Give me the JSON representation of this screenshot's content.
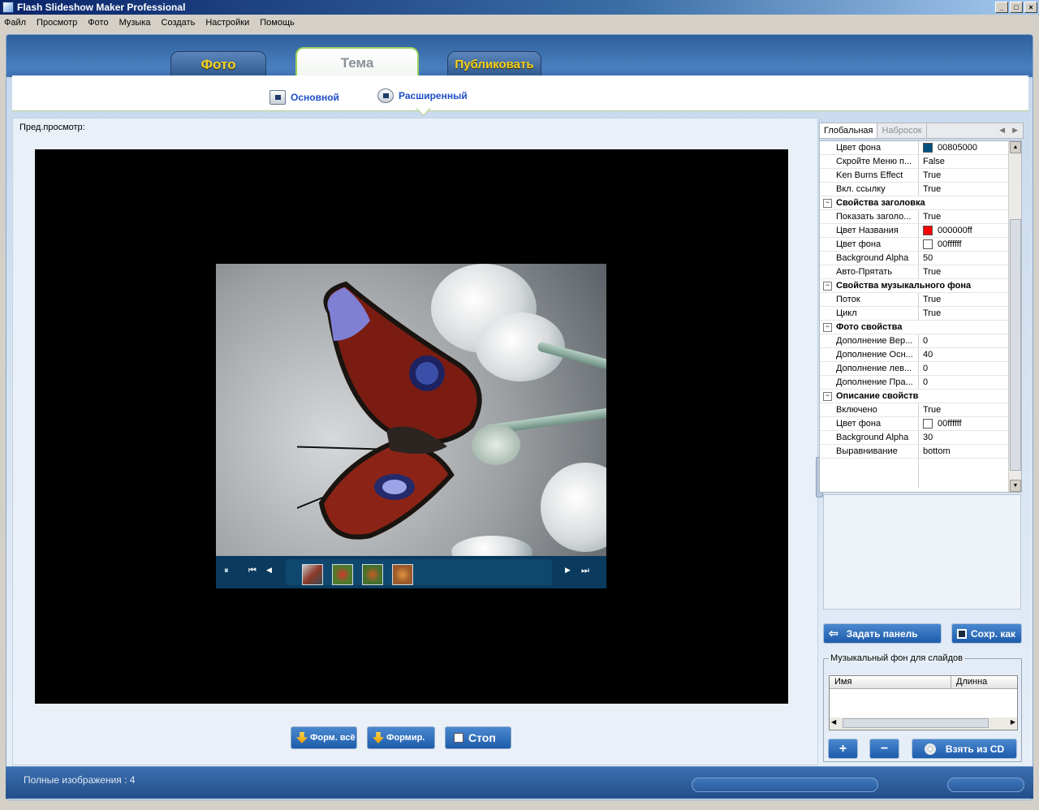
{
  "window": {
    "title": "Flash Slideshow Maker Professional",
    "controls": [
      "_",
      "□",
      "×"
    ]
  },
  "menu": [
    "Файл",
    "Просмотр",
    "Фото",
    "Музыка",
    "Создать",
    "Настройки",
    "Помощь"
  ],
  "main_tabs": [
    {
      "label": "Фото"
    },
    {
      "label": "Тема"
    },
    {
      "label": "Публиковать"
    }
  ],
  "sub_tabs": [
    {
      "label": "Основной"
    },
    {
      "label": "Расширенный"
    }
  ],
  "preview": {
    "label": "Пред.просмотр:"
  },
  "player": {
    "pause": "⏸",
    "first": "⏮",
    "prev": "◀",
    "next": "▶",
    "last": "⏭",
    "thumb_count": 4
  },
  "actions": {
    "render_all": "Форм. всё",
    "render": "Формир.",
    "stop": "Стоп"
  },
  "panel": {
    "tabs": [
      "Глобальная",
      "Набросок"
    ],
    "rows": [
      {
        "k": "Цвет фона",
        "v": "00805000",
        "color": "#005080"
      },
      {
        "k": "Скройте Меню п...",
        "v": "False"
      },
      {
        "k": "Ken Burns Effect",
        "v": "True"
      },
      {
        "k": "Вкл. ссылку",
        "v": "True"
      },
      {
        "cat": "Свойства заголовка"
      },
      {
        "k": "Показать заголо...",
        "v": "True"
      },
      {
        "k": "Цвет Названия",
        "v": "000000ff",
        "color": "#ff0000"
      },
      {
        "k": "Цвет фона",
        "v": "00ffffff",
        "color": "#ffffff"
      },
      {
        "k": "Background Alpha",
        "v": "50"
      },
      {
        "k": "Авто-Прятать",
        "v": "True"
      },
      {
        "cat": "Свойства музыкального фона"
      },
      {
        "k": "Поток",
        "v": "True"
      },
      {
        "k": "Цикл",
        "v": "True"
      },
      {
        "cat": "Фото свойства"
      },
      {
        "k": "Дополнение Вер...",
        "v": "0"
      },
      {
        "k": "Дополнение Осн...",
        "v": "40"
      },
      {
        "k": "Дополнение лев...",
        "v": "0"
      },
      {
        "k": "Дополнение Пра...",
        "v": "0"
      },
      {
        "cat": "Описание свойств"
      },
      {
        "k": "Включено",
        "v": "True"
      },
      {
        "k": "Цвет фона",
        "v": "00ffffff",
        "color": "#ffffff"
      },
      {
        "k": "Background Alpha",
        "v": "30"
      },
      {
        "k": "Выравнивание",
        "v": "bottom"
      }
    ],
    "set_panel": "Задать панель",
    "save_as": "Сохр. как"
  },
  "music": {
    "legend": "Музыкальный фон для слайдов",
    "col_name": "Имя",
    "col_length": "Длинна",
    "add": "+",
    "remove": "−",
    "from_cd": "Взять из CD"
  },
  "status": {
    "text": "Полные изображения : 4"
  }
}
